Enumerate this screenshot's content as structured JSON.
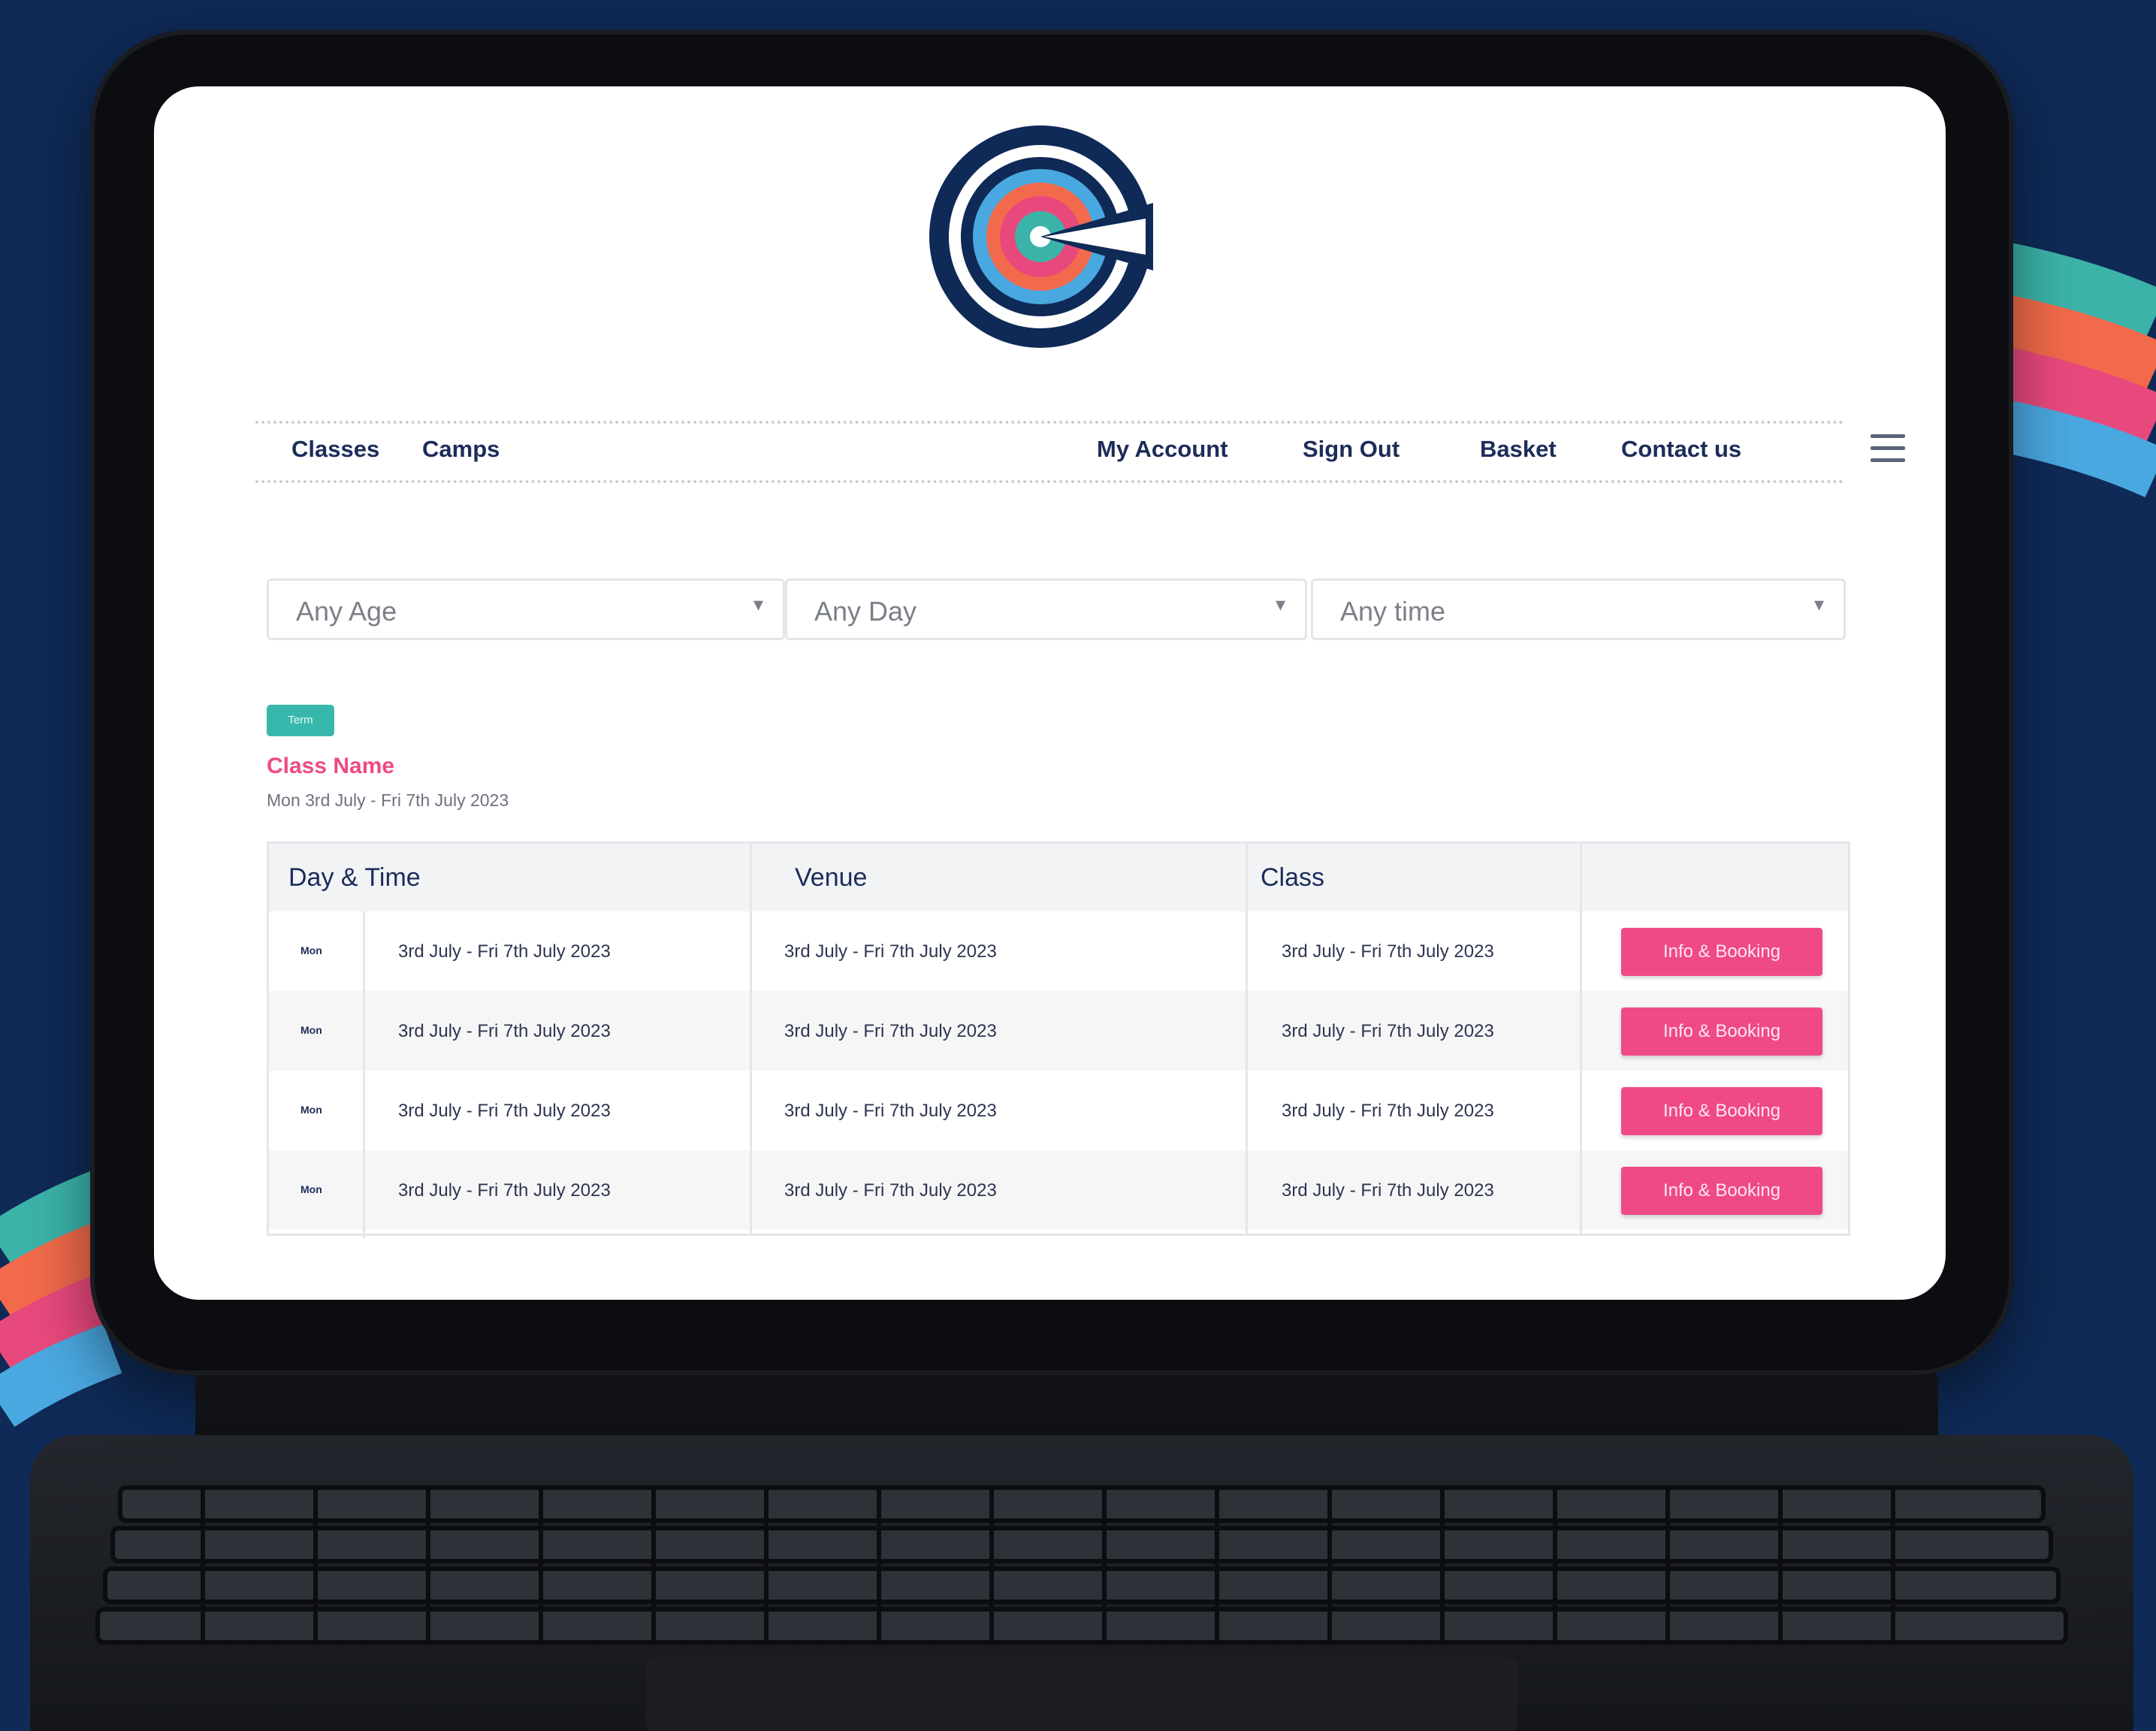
{
  "colors": {
    "background": "#0f2a57",
    "accent_pink": "#ef4a86",
    "accent_teal": "#38b8ac",
    "navy_text": "#1c2c5a"
  },
  "nav": {
    "left": [
      "Classes",
      "Camps"
    ],
    "right": [
      "My Account",
      "Sign Out",
      "Basket",
      "Contact us"
    ],
    "menu_icon": "hamburger-icon"
  },
  "filters": [
    {
      "value": "Any Age"
    },
    {
      "value": "Any Day"
    },
    {
      "value": "Any time"
    }
  ],
  "listing": {
    "badge": "Term",
    "class_name": "Class Name",
    "dates": "Mon 3rd July - Fri 7th July 2023"
  },
  "table": {
    "headers": [
      "Day & Time",
      "Venue",
      "Class",
      ""
    ],
    "rows": [
      {
        "day": "Mon",
        "time": "3rd July - Fri 7th July 2023",
        "venue": "3rd July - Fri 7th July 2023",
        "class": "3rd July - Fri 7th July 2023",
        "action": "Info & Booking"
      },
      {
        "day": "Mon",
        "time": "3rd July - Fri 7th July 2023",
        "venue": "3rd July - Fri 7th July 2023",
        "class": "3rd July - Fri 7th July 2023",
        "action": "Info & Booking"
      },
      {
        "day": "Mon",
        "time": "3rd July - Fri 7th July 2023",
        "venue": "3rd July - Fri 7th July 2023",
        "class": "3rd July - Fri 7th July 2023",
        "action": "Info & Booking"
      },
      {
        "day": "Mon",
        "time": "3rd July - Fri 7th July 2023",
        "venue": "3rd July - Fri 7th July 2023",
        "class": "3rd July - Fri 7th July 2023",
        "action": "Info & Booking"
      }
    ]
  }
}
